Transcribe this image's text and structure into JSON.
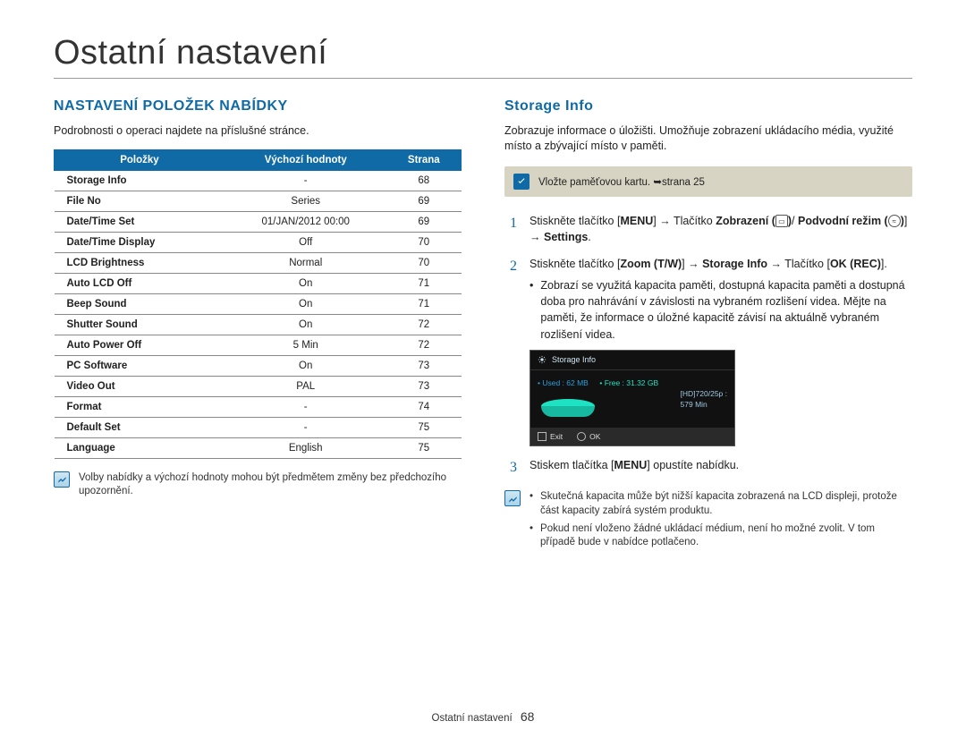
{
  "pageTitle": "Ostatní nastavení",
  "left": {
    "heading": "NASTAVENÍ POLOŽEK NABÍDKY",
    "intro": "Podrobnosti o operaci najdete na příslušné stránce.",
    "headers": {
      "item": "Položky",
      "default": "Výchozí hodnoty",
      "page": "Strana"
    },
    "rows": [
      {
        "item": "Storage Info",
        "default": "-",
        "page": "68"
      },
      {
        "item": "File No",
        "default": "Series",
        "page": "69"
      },
      {
        "item": "Date/Time Set",
        "default": "01/JAN/2012 00:00",
        "page": "69"
      },
      {
        "item": "Date/Time Display",
        "default": "Off",
        "page": "70"
      },
      {
        "item": "LCD Brightness",
        "default": "Normal",
        "page": "70"
      },
      {
        "item": "Auto LCD Off",
        "default": "On",
        "page": "71"
      },
      {
        "item": "Beep Sound",
        "default": "On",
        "page": "71"
      },
      {
        "item": "Shutter Sound",
        "default": "On",
        "page": "72"
      },
      {
        "item": "Auto Power Off",
        "default": "5 Min",
        "page": "72"
      },
      {
        "item": "PC Software",
        "default": "On",
        "page": "73"
      },
      {
        "item": "Video Out",
        "default": "PAL",
        "page": "73"
      },
      {
        "item": "Format",
        "default": "-",
        "page": "74"
      },
      {
        "item": "Default Set",
        "default": "-",
        "page": "75"
      },
      {
        "item": "Language",
        "default": "English",
        "page": "75"
      }
    ],
    "note": "Volby nabídky a výchozí hodnoty mohou být předmětem změny bez předchozího upozornění."
  },
  "right": {
    "heading": "Storage Info",
    "intro": "Zobrazuje informace o úložišti. Umožňuje zobrazení ukládacího média, využité místo a zbývající místo v paměti.",
    "callout": "Vložte paměťovou kartu. ➥strana 25",
    "steps": {
      "s1a": "Stiskněte tlačítko [",
      "s1_menu": "MENU",
      "s1b_arrow": "] → Tlačítko ",
      "s1_disp": "Zobrazení (",
      "s1_disp_close": ")",
      "s1_slash": "/",
      "s1_under": "Podvodní režim (",
      "s1_under_close": ")",
      "s1_arrow2": "] → ",
      "s1_settings": "Settings",
      "s1_end": ".",
      "s2a": "Stiskněte tlačítko [",
      "s2_zoom": "Zoom (T/W)",
      "s2_arrow": "] → ",
      "s2_storage": "Storage Info",
      "s2_arrow2": " → Tlačítko [",
      "s2_ok": "OK (REC)",
      "s2_end": "].",
      "s2_bullet": "Zobrazí se využitá kapacita paměti, dostupná kapacita paměti a dostupná doba pro nahrávání v závislosti na vybraném rozlišení videa. Mějte na paměti, že informace o úložné kapacitě závisí na aktuálně vybraném rozlišení videa.",
      "s3a": "Stiskem tlačítka [",
      "s3_menu": "MENU",
      "s3b": "] opustíte nabídku."
    },
    "lcd": {
      "title": "Storage Info",
      "used": "• Used : 62 MB",
      "free": "• Free : 31.32 GB",
      "res": "[HD]720/25p :",
      "min": "579 Min",
      "exit": "Exit",
      "ok": "OK"
    },
    "notes": [
      "Skutečná kapacita může být nižší kapacita zobrazená na LCD displeji, protože část kapacity zabírá systém produktu.",
      "Pokud není vloženo žádné ukládací médium, není ho možné zvolit. V tom případě bude v nabídce potlačeno."
    ]
  },
  "footer": {
    "label": "Ostatní nastavení",
    "page": "68"
  }
}
